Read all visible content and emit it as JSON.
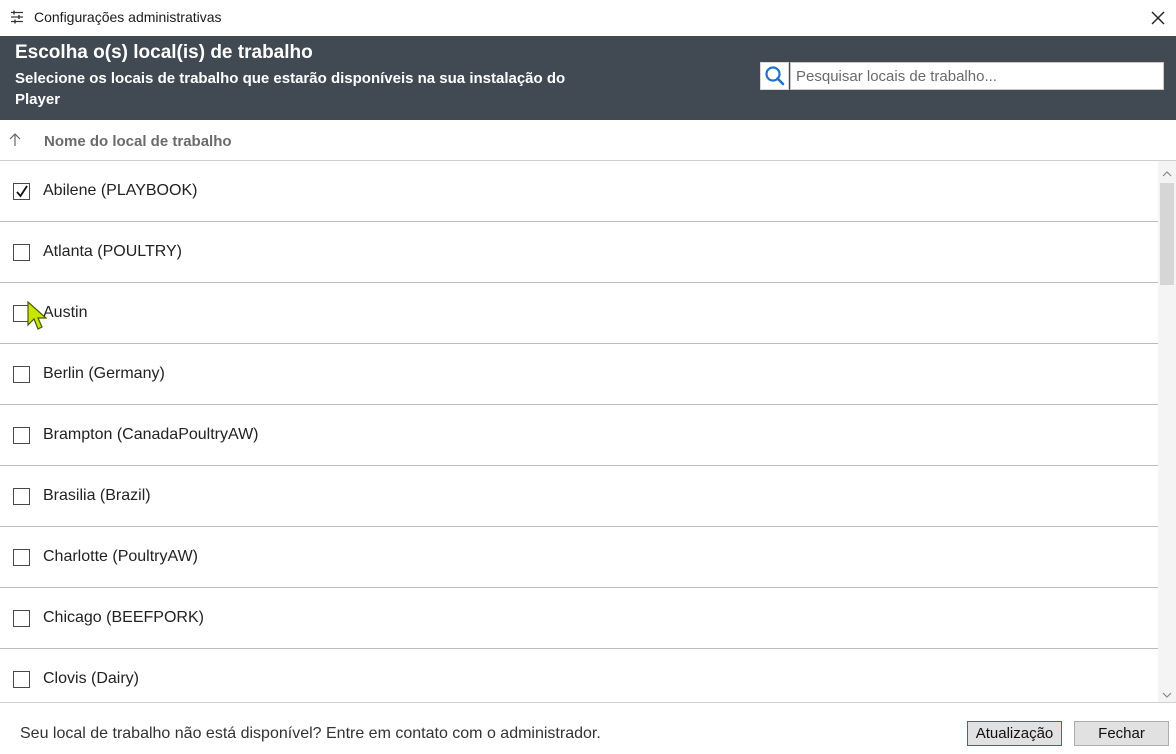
{
  "window": {
    "title": "Configurações administrativas",
    "icon": "settings-sliders-icon",
    "close_icon": "close-icon"
  },
  "banner": {
    "heading": "Escolha o(s) local(is) de trabalho",
    "subtitle": "Selecione os locais de trabalho que estarão disponíveis na sua instalação do Player",
    "background_color": "#414a53"
  },
  "search": {
    "icon": "search-icon",
    "placeholder": "Pesquisar locais de trabalho...",
    "value": ""
  },
  "table": {
    "sort_icon": "sort-ascending-arrow-icon",
    "column_header": "Nome do local de trabalho",
    "rows": [
      {
        "name": "Abilene (PLAYBOOK)",
        "checked": true
      },
      {
        "name": "Atlanta (POULTRY)",
        "checked": false
      },
      {
        "name": "Austin",
        "checked": false
      },
      {
        "name": "Berlin (Germany)",
        "checked": false
      },
      {
        "name": "Brampton (CanadaPoultryAW)",
        "checked": false
      },
      {
        "name": "Brasilia (Brazil)",
        "checked": false
      },
      {
        "name": "Charlotte (PoultryAW)",
        "checked": false
      },
      {
        "name": "Chicago (BEEFPORK)",
        "checked": false
      },
      {
        "name": "Clovis (Dairy)",
        "checked": false
      }
    ]
  },
  "footer": {
    "message": "Seu local de trabalho não está disponível? Entre em contato com o administrador.",
    "update_label": "Atualização",
    "close_label": "Fechar"
  }
}
